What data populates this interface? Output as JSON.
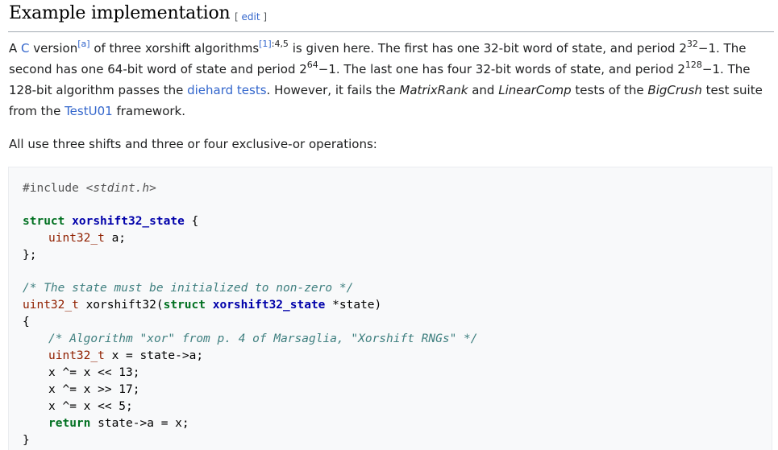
{
  "section": {
    "title": "Example implementation",
    "edit_open": "[ ",
    "edit_label": "edit",
    "edit_close": " ]"
  },
  "intro": {
    "t1": "A ",
    "link_c": "C",
    "t2": " version",
    "note_a": "[a]",
    "t3": " of three xorshift algorithms",
    "cite_1": "[1]",
    "cite_pages": ":4,5",
    "t4": " is given here. The first has one 32-bit word of state, and period 2",
    "exp_32": "32",
    "t5": "−1. The second has one 64-bit word of state and period 2",
    "exp_64": "64",
    "t6": "−1. The last one has four 32-bit words of state, and period 2",
    "exp_128": "128",
    "t7": "−1. The 128-bit algorithm passes the ",
    "link_diehard": "diehard tests",
    "t8": ". However, it fails the ",
    "test_matrix": "MatrixRank",
    "t9": " and ",
    "test_linear": "LinearComp",
    "t10": " tests of the ",
    "suite_bigcrush": "BigCrush",
    "t11": " test suite from the ",
    "link_testu01": "TestU01",
    "t12": " framework."
  },
  "summary": "All use three shifts and three or four exclusive-or operations:",
  "code": {
    "l1_directive": "#include ",
    "l1_header": "<stdint.h>",
    "l3_kw": "struct",
    "l3_name": "xorshift32_state",
    "l3_brace": " {",
    "l4_type": "uint32_t",
    "l4_rest": " a;",
    "l5": "};",
    "l7_comment": "/* The state must be initialized to non-zero */",
    "l8_type": "uint32_t",
    "l8_func": " xorshift32(",
    "l8_kw": "struct",
    "l8_name": "xorshift32_state",
    "l8_rest": " *state)",
    "l9": "{",
    "l10_comment": "/* Algorithm \"xor\" from p. 4 of Marsaglia, \"Xorshift RNGs\" */",
    "l11_type": "uint32_t",
    "l11_rest": " x = state->a;",
    "l12": "x ^= x << 13;",
    "l13": "x ^= x >> 17;",
    "l14": "x ^= x << 5;",
    "l15_kw": "return",
    "l15_rest": " state->a = x;",
    "l16": "}"
  }
}
